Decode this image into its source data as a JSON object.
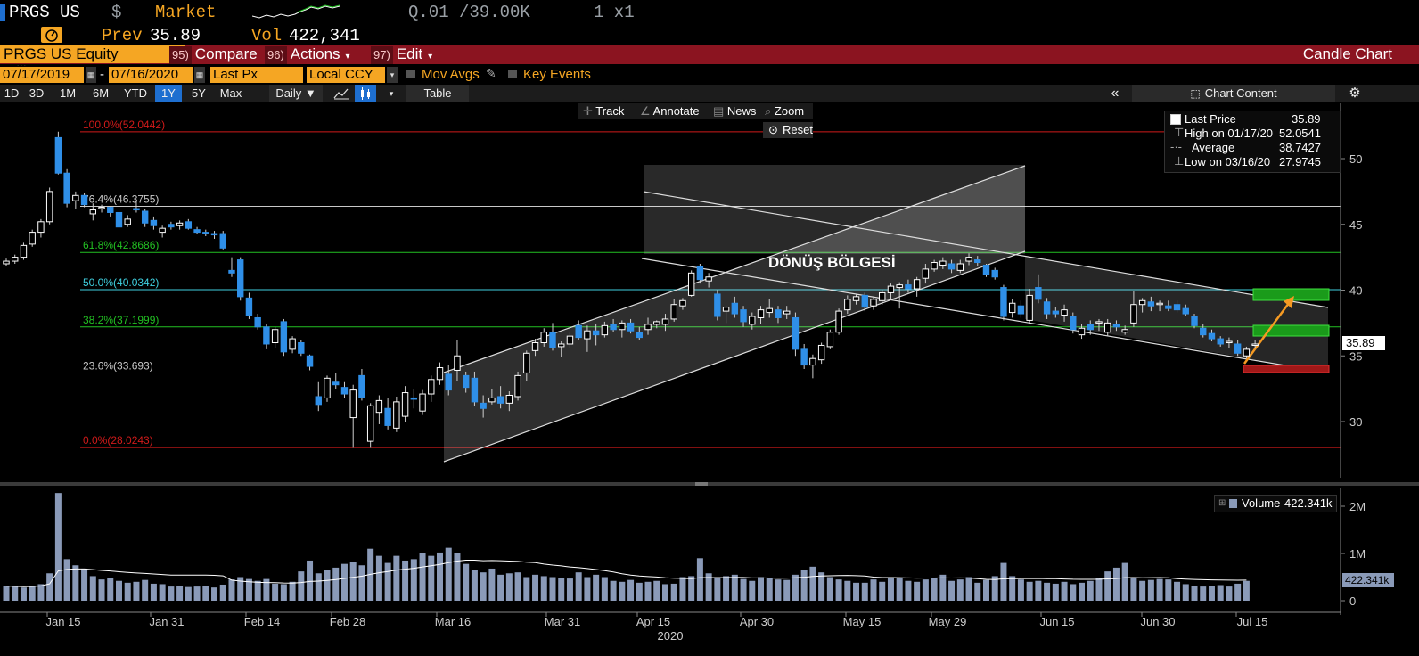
{
  "header": {
    "ticker": "PRGS US",
    "currency": "$",
    "market": "Market",
    "quote": "Q.01 /39.00K",
    "size": "1 x1",
    "prev_label": "Prev",
    "prev_value": "35.89",
    "vol_label": "Vol",
    "vol_value": "422,341"
  },
  "menubar": {
    "security": "PRGS US Equity",
    "compare": {
      "num": "95)",
      "label": "Compare"
    },
    "actions": {
      "num": "96)",
      "label": "Actions"
    },
    "edit": {
      "num": "97)",
      "label": "Edit"
    },
    "chart_type": "Candle Chart"
  },
  "params": {
    "start_date": "07/17/2019",
    "end_date": "07/16/2020",
    "separator": "-",
    "field": "Last Px",
    "currency": "Local CCY",
    "mov_avgs": "Mov Avgs",
    "key_events": "Key Events"
  },
  "periods": [
    "1D",
    "3D",
    "1M",
    "6M",
    "YTD",
    "1Y",
    "5Y",
    "Max"
  ],
  "selected_period": "1Y",
  "frequency": "Daily ▼",
  "table_button": "Table",
  "chart_content": "Chart Content",
  "chart_tools": {
    "track": "Track",
    "annotate": "Annotate",
    "news": "News",
    "zoom": "Zoom",
    "reset": "Reset"
  },
  "legend": {
    "last_price_label": "Last Price",
    "last_price": "35.89",
    "high_label": "High on 01/17/20",
    "high": "52.0541",
    "average_label": "Average",
    "average": "38.7427",
    "low_label": "Low on 03/16/20",
    "low": "27.9745"
  },
  "volume_legend": {
    "label": "Volume",
    "value": "422.341k"
  },
  "annotation": "DÖNÜŞ BÖLGESİ",
  "price_tag": "35.89",
  "volume_tag": "422.341k",
  "colors": {
    "up": "#ffffff",
    "down": "#2f8fe8",
    "bar": "#8a9ab8",
    "accent": "#f5a623",
    "menubar": "#8b1420"
  },
  "chart_data": {
    "type": "candlestick",
    "y_ticks": [
      30,
      35,
      40,
      45,
      50
    ],
    "ylim": [
      26,
      54
    ],
    "volume_ticks": [
      "2M",
      "1M",
      "0"
    ],
    "x_ticks": [
      "Jan 15",
      "Jan 31",
      "Feb 14",
      "Feb 28",
      "Mar 16",
      "Mar 31",
      "Apr 15",
      "Apr 30",
      "May 15",
      "May 29",
      "Jun 15",
      "Jun 30",
      "Jul 15"
    ],
    "x_year_label": "2020",
    "fib_levels": [
      {
        "label": "100.0%(52.0442)",
        "value": 52.0442,
        "color": "#d01a1a"
      },
      {
        "label": "76.4%(46.3755)",
        "value": 46.3755,
        "color": "#c8c8c8"
      },
      {
        "label": "61.8%(42.8686)",
        "value": 42.8686,
        "color": "#22c022"
      },
      {
        "label": "50.0%(40.0342)",
        "value": 40.0342,
        "color": "#3fd0e0"
      },
      {
        "label": "38.2%(37.1999)",
        "value": 37.1999,
        "color": "#22c022"
      },
      {
        "label": "23.6%(33.693)",
        "value": 33.693,
        "color": "#c8c8c8"
      },
      {
        "label": "0.0%(28.0243)",
        "value": 28.0243,
        "color": "#d01a1a"
      }
    ],
    "candles": [
      [
        42.0,
        42.4,
        41.8,
        42.2
      ],
      [
        42.2,
        42.7,
        42.0,
        42.5
      ],
      [
        42.5,
        43.6,
        42.3,
        43.4
      ],
      [
        43.5,
        44.6,
        43.3,
        44.4
      ],
      [
        44.4,
        45.4,
        44.0,
        45.2
      ],
      [
        45.2,
        47.8,
        45.0,
        47.5
      ],
      [
        51.6,
        52.05,
        48.8,
        48.9
      ],
      [
        48.9,
        49.2,
        46.3,
        46.6
      ],
      [
        46.8,
        47.5,
        46.2,
        47.2
      ],
      [
        47.2,
        47.4,
        46.3,
        46.5
      ],
      [
        45.8,
        46.6,
        45.3,
        46.1
      ],
      [
        46.2,
        46.5,
        45.9,
        46.3
      ],
      [
        46.3,
        46.4,
        45.6,
        45.9
      ],
      [
        45.9,
        46.1,
        44.5,
        44.8
      ],
      [
        45.0,
        45.7,
        44.8,
        45.4
      ],
      [
        46.2,
        46.8,
        45.9,
        46.1
      ],
      [
        46.0,
        46.2,
        44.8,
        45.1
      ],
      [
        45.3,
        45.6,
        44.6,
        44.9
      ],
      [
        44.4,
        44.9,
        44.0,
        44.7
      ],
      [
        45.0,
        45.2,
        44.6,
        44.8
      ],
      [
        44.9,
        45.3,
        44.6,
        45.1
      ],
      [
        45.2,
        45.4,
        44.6,
        44.7
      ],
      [
        44.6,
        44.8,
        44.3,
        44.4
      ],
      [
        44.4,
        44.6,
        44.1,
        44.3
      ],
      [
        44.3,
        44.5,
        43.9,
        44.2
      ],
      [
        44.3,
        44.5,
        43.1,
        43.2
      ],
      [
        41.5,
        42.5,
        41.0,
        41.3
      ],
      [
        42.3,
        42.5,
        39.2,
        39.5
      ],
      [
        39.4,
        39.8,
        37.8,
        38.1
      ],
      [
        37.9,
        38.2,
        37.0,
        37.2
      ],
      [
        37.2,
        37.4,
        35.5,
        35.9
      ],
      [
        36.0,
        37.2,
        35.6,
        37.0
      ],
      [
        37.6,
        37.8,
        35.0,
        35.3
      ],
      [
        35.5,
        36.5,
        35.2,
        36.3
      ],
      [
        36.0,
        36.2,
        35.0,
        35.2
      ],
      [
        35.0,
        35.1,
        33.9,
        34.2
      ],
      [
        31.9,
        33.0,
        30.8,
        31.3
      ],
      [
        31.8,
        33.5,
        31.5,
        33.3
      ],
      [
        33.0,
        33.7,
        32.5,
        32.8
      ],
      [
        32.6,
        33.0,
        31.8,
        32.1
      ],
      [
        30.3,
        32.8,
        28.0,
        32.4
      ],
      [
        33.5,
        34.0,
        31.6,
        31.8
      ],
      [
        28.5,
        31.4,
        28.0,
        31.2
      ],
      [
        30.7,
        32.0,
        29.8,
        31.6
      ],
      [
        31.0,
        31.8,
        29.4,
        29.7
      ],
      [
        29.5,
        31.9,
        29.2,
        31.5
      ],
      [
        30.4,
        32.7,
        30.0,
        32.2
      ],
      [
        31.8,
        32.5,
        31.0,
        31.7
      ],
      [
        30.8,
        32.4,
        30.5,
        32.1
      ],
      [
        32.1,
        33.5,
        31.5,
        33.2
      ],
      [
        33.2,
        34.5,
        32.8,
        34.1
      ],
      [
        33.6,
        34.3,
        32.0,
        32.4
      ],
      [
        33.9,
        36.2,
        33.1,
        35.0
      ],
      [
        33.5,
        33.8,
        32.2,
        32.6
      ],
      [
        33.3,
        33.8,
        31.2,
        31.5
      ],
      [
        31.4,
        32.0,
        30.3,
        31.0
      ],
      [
        31.5,
        32.5,
        31.3,
        31.8
      ],
      [
        31.9,
        32.7,
        31.0,
        31.4
      ],
      [
        31.4,
        32.3,
        30.8,
        32.0
      ],
      [
        31.9,
        33.8,
        31.6,
        33.5
      ],
      [
        33.7,
        35.4,
        33.1,
        35.2
      ],
      [
        35.4,
        36.3,
        35.0,
        36.0
      ],
      [
        36.0,
        37.1,
        35.7,
        36.8
      ],
      [
        36.8,
        37.5,
        35.4,
        35.6
      ],
      [
        35.7,
        36.1,
        34.9,
        35.9
      ],
      [
        35.9,
        36.8,
        35.6,
        36.5
      ],
      [
        37.3,
        37.7,
        36.2,
        36.4
      ],
      [
        36.3,
        37.3,
        35.3,
        36.9
      ],
      [
        36.9,
        37.4,
        35.8,
        36.6
      ],
      [
        36.6,
        37.6,
        36.4,
        37.3
      ],
      [
        37.4,
        37.8,
        36.8,
        37.0
      ],
      [
        37.0,
        37.7,
        36.4,
        37.5
      ],
      [
        37.5,
        37.8,
        36.7,
        36.9
      ],
      [
        36.8,
        37.2,
        36.2,
        36.4
      ],
      [
        37.0,
        37.9,
        36.6,
        37.4
      ],
      [
        37.4,
        37.7,
        37.1,
        37.6
      ],
      [
        37.4,
        38.2,
        36.9,
        37.8
      ],
      [
        37.8,
        39.3,
        37.6,
        38.9
      ],
      [
        38.8,
        39.4,
        38.5,
        39.2
      ],
      [
        39.6,
        41.5,
        39.5,
        41.3
      ],
      [
        41.8,
        42.0,
        40.5,
        40.8
      ],
      [
        40.7,
        41.3,
        40.2,
        41.0
      ],
      [
        39.7,
        40.0,
        37.7,
        38.0
      ],
      [
        38.4,
        38.8,
        37.5,
        38.7
      ],
      [
        39.0,
        39.5,
        37.9,
        38.2
      ],
      [
        38.5,
        38.8,
        37.2,
        37.6
      ],
      [
        37.4,
        38.3,
        37.0,
        38.0
      ],
      [
        37.9,
        38.8,
        37.4,
        38.5
      ],
      [
        38.3,
        39.3,
        37.9,
        38.6
      ],
      [
        38.5,
        38.8,
        37.5,
        37.9
      ],
      [
        38.2,
        38.8,
        37.8,
        38.4
      ],
      [
        37.9,
        38.3,
        35.0,
        35.5
      ],
      [
        35.5,
        35.9,
        34.0,
        34.3
      ],
      [
        34.3,
        35.1,
        33.3,
        34.8
      ],
      [
        34.7,
        36.0,
        34.4,
        35.8
      ],
      [
        35.7,
        37.0,
        35.5,
        36.8
      ],
      [
        36.8,
        38.6,
        36.6,
        38.4
      ],
      [
        38.5,
        39.6,
        38.2,
        39.3
      ],
      [
        39.2,
        39.7,
        38.9,
        39.5
      ],
      [
        39.6,
        39.8,
        38.4,
        38.7
      ],
      [
        38.8,
        39.5,
        38.5,
        39.3
      ],
      [
        39.2,
        40.0,
        38.9,
        39.8
      ],
      [
        39.8,
        40.5,
        39.3,
        40.3
      ],
      [
        40.2,
        40.6,
        38.6,
        40.4
      ],
      [
        40.4,
        40.8,
        39.8,
        40.1
      ],
      [
        40.1,
        41.0,
        39.5,
        40.8
      ],
      [
        40.9,
        42.0,
        40.5,
        41.6
      ],
      [
        41.6,
        42.3,
        41.4,
        42.1
      ],
      [
        41.9,
        42.5,
        41.6,
        42.2
      ],
      [
        42.0,
        42.3,
        41.3,
        41.6
      ],
      [
        41.5,
        42.3,
        41.3,
        42.0
      ],
      [
        42.2,
        42.8,
        41.9,
        42.5
      ],
      [
        42.3,
        42.6,
        41.8,
        42.1
      ],
      [
        41.9,
        42.0,
        41.0,
        41.2
      ],
      [
        41.5,
        41.7,
        40.8,
        41.0
      ],
      [
        40.2,
        40.4,
        37.7,
        38.0
      ],
      [
        38.3,
        39.3,
        37.9,
        39.0
      ],
      [
        38.8,
        39.2,
        37.9,
        38.2
      ],
      [
        37.7,
        40.1,
        37.5,
        39.6
      ],
      [
        40.2,
        41.2,
        39.0,
        39.3
      ],
      [
        39.1,
        39.4,
        37.8,
        38.2
      ],
      [
        38.4,
        38.7,
        37.9,
        38.2
      ],
      [
        38.1,
        38.9,
        37.6,
        38.5
      ],
      [
        38.0,
        38.3,
        36.7,
        37.0
      ],
      [
        36.6,
        37.4,
        36.3,
        37.1
      ],
      [
        37.4,
        37.7,
        36.6,
        37.0
      ],
      [
        37.5,
        37.8,
        36.9,
        37.6
      ],
      [
        36.8,
        37.8,
        36.5,
        37.5
      ],
      [
        37.4,
        37.7,
        36.9,
        37.2
      ],
      [
        36.8,
        37.3,
        36.6,
        37.0
      ],
      [
        37.5,
        39.9,
        37.2,
        38.9
      ],
      [
        38.9,
        39.4,
        38.3,
        39.2
      ],
      [
        39.1,
        39.5,
        38.4,
        38.8
      ],
      [
        38.9,
        39.2,
        38.4,
        39.0
      ],
      [
        38.8,
        39.2,
        38.4,
        38.6
      ],
      [
        38.9,
        39.2,
        38.3,
        38.5
      ],
      [
        38.6,
        38.9,
        38.0,
        38.2
      ],
      [
        38.0,
        38.2,
        37.1,
        37.3
      ],
      [
        37.1,
        37.4,
        36.4,
        36.6
      ],
      [
        36.7,
        37.0,
        36.1,
        36.3
      ],
      [
        36.3,
        36.5,
        35.7,
        35.9
      ],
      [
        36.0,
        36.4,
        35.6,
        36.1
      ],
      [
        35.9,
        36.2,
        35.0,
        35.2
      ],
      [
        35.0,
        35.7,
        34.8,
        35.5
      ],
      [
        35.8,
        36.2,
        35.6,
        35.9
      ]
    ],
    "volume_m": [
      0.31,
      0.3,
      0.28,
      0.32,
      0.35,
      0.58,
      2.28,
      0.88,
      0.75,
      0.68,
      0.52,
      0.45,
      0.48,
      0.42,
      0.38,
      0.4,
      0.44,
      0.36,
      0.35,
      0.3,
      0.32,
      0.29,
      0.3,
      0.31,
      0.28,
      0.34,
      0.45,
      0.5,
      0.46,
      0.42,
      0.46,
      0.36,
      0.35,
      0.4,
      0.62,
      0.85,
      0.58,
      0.66,
      0.7,
      0.78,
      0.82,
      0.75,
      1.1,
      0.95,
      0.8,
      0.95,
      0.85,
      0.88,
      1.0,
      0.95,
      1.02,
      1.12,
      1.0,
      0.78,
      0.65,
      0.6,
      0.68,
      0.55,
      0.58,
      0.6,
      0.5,
      0.55,
      0.52,
      0.5,
      0.48,
      0.47,
      0.6,
      0.5,
      0.55,
      0.5,
      0.42,
      0.4,
      0.44,
      0.38,
      0.4,
      0.42,
      0.35,
      0.36,
      0.5,
      0.52,
      0.9,
      0.58,
      0.5,
      0.52,
      0.55,
      0.46,
      0.42,
      0.5,
      0.48,
      0.45,
      0.44,
      0.55,
      0.65,
      0.72,
      0.6,
      0.5,
      0.45,
      0.42,
      0.38,
      0.38,
      0.45,
      0.4,
      0.5,
      0.48,
      0.42,
      0.4,
      0.45,
      0.48,
      0.55,
      0.42,
      0.45,
      0.5,
      0.38,
      0.44,
      0.52,
      0.8,
      0.52,
      0.45,
      0.4,
      0.42,
      0.38,
      0.36,
      0.4,
      0.35,
      0.38,
      0.42,
      0.48,
      0.62,
      0.7,
      0.8,
      0.48,
      0.42,
      0.44,
      0.46,
      0.45,
      0.4,
      0.35,
      0.32,
      0.3,
      0.31,
      0.33,
      0.3,
      0.36,
      0.42
    ]
  }
}
